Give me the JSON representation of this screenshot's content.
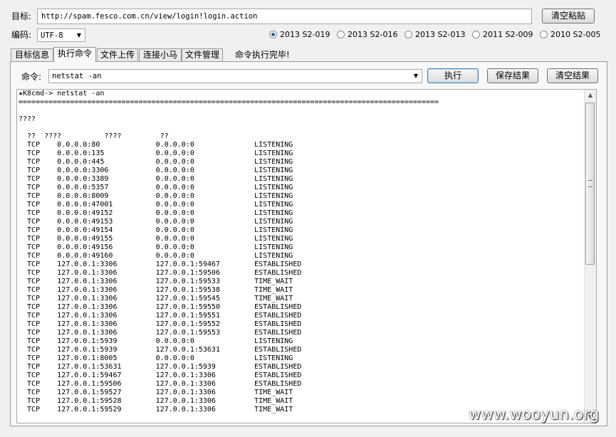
{
  "target": {
    "label": "目标:",
    "url": "http://spam.fesco.com.cn/view/login!login.action",
    "clear_paste": "清空粘贴"
  },
  "encoding": {
    "label": "编码:",
    "value": "UTF-8"
  },
  "exploits": [
    {
      "label": "2013 S2-019",
      "selected": true
    },
    {
      "label": "2013 S2-016",
      "selected": false
    },
    {
      "label": "2013 S2-013",
      "selected": false
    },
    {
      "label": "2011 S2-009",
      "selected": false
    },
    {
      "label": "2010 S2-005",
      "selected": false
    }
  ],
  "tabs": [
    "目标信息",
    "执行命令",
    "文件上传",
    "连接小马",
    "文件管理"
  ],
  "active_tab": "执行命令",
  "status": "命令执行完毕!",
  "command": {
    "label": "命令:",
    "value": "netstat -an",
    "execute": "执行",
    "save": "保存结果",
    "clear": "清空结果"
  },
  "output": {
    "prompt": "★K8cmd-> netstat -an",
    "separator": "==================================================================================================",
    "header1": "????",
    "columns": "  ??  ????          ????         ??",
    "rows": [
      [
        "TCP",
        "0.0.0.0:80",
        "0.0.0.0:0",
        "LISTENING"
      ],
      [
        "TCP",
        "0.0.0.0:135",
        "0.0.0.0:0",
        "LISTENING"
      ],
      [
        "TCP",
        "0.0.0.0:445",
        "0.0.0.0:0",
        "LISTENING"
      ],
      [
        "TCP",
        "0.0.0.0:3306",
        "0.0.0.0:0",
        "LISTENING"
      ],
      [
        "TCP",
        "0.0.0.0:3389",
        "0.0.0.0:0",
        "LISTENING"
      ],
      [
        "TCP",
        "0.0.0.0:5357",
        "0.0.0.0:0",
        "LISTENING"
      ],
      [
        "TCP",
        "0.0.0.0:8009",
        "0.0.0.0:0",
        "LISTENING"
      ],
      [
        "TCP",
        "0.0.0.0:47001",
        "0.0.0.0:0",
        "LISTENING"
      ],
      [
        "TCP",
        "0.0.0.0:49152",
        "0.0.0.0:0",
        "LISTENING"
      ],
      [
        "TCP",
        "0.0.0.0:49153",
        "0.0.0.0:0",
        "LISTENING"
      ],
      [
        "TCP",
        "0.0.0.0:49154",
        "0.0.0.0:0",
        "LISTENING"
      ],
      [
        "TCP",
        "0.0.0.0:49155",
        "0.0.0.0:0",
        "LISTENING"
      ],
      [
        "TCP",
        "0.0.0.0:49156",
        "0.0.0.0:0",
        "LISTENING"
      ],
      [
        "TCP",
        "0.0.0.0:49160",
        "0.0.0.0:0",
        "LISTENING"
      ],
      [
        "TCP",
        "127.0.0.1:3306",
        "127.0.0.1:59467",
        "ESTABLISHED"
      ],
      [
        "TCP",
        "127.0.0.1:3306",
        "127.0.0.1:59506",
        "ESTABLISHED"
      ],
      [
        "TCP",
        "127.0.0.1:3306",
        "127.0.0.1:59533",
        "TIME_WAIT"
      ],
      [
        "TCP",
        "127.0.0.1:3306",
        "127.0.0.1:59538",
        "TIME_WAIT"
      ],
      [
        "TCP",
        "127.0.0.1:3306",
        "127.0.0.1:59545",
        "TIME_WAIT"
      ],
      [
        "TCP",
        "127.0.0.1:3306",
        "127.0.0.1:59550",
        "ESTABLISHED"
      ],
      [
        "TCP",
        "127.0.0.1:3306",
        "127.0.0.1:59551",
        "ESTABLISHED"
      ],
      [
        "TCP",
        "127.0.0.1:3306",
        "127.0.0.1:59552",
        "ESTABLISHED"
      ],
      [
        "TCP",
        "127.0.0.1:3306",
        "127.0.0.1:59553",
        "ESTABLISHED"
      ],
      [
        "TCP",
        "127.0.0.1:5939",
        "0.0.0.0:0",
        "LISTENING"
      ],
      [
        "TCP",
        "127.0.0.1:5939",
        "127.0.0.1:53631",
        "ESTABLISHED"
      ],
      [
        "TCP",
        "127.0.0.1:8005",
        "0.0.0.0:0",
        "LISTENING"
      ],
      [
        "TCP",
        "127.0.0.1:53631",
        "127.0.0.1:5939",
        "ESTABLISHED"
      ],
      [
        "TCP",
        "127.0.0.1:59467",
        "127.0.0.1:3306",
        "ESTABLISHED"
      ],
      [
        "TCP",
        "127.0.0.1:59506",
        "127.0.0.1:3306",
        "ESTABLISHED"
      ],
      [
        "TCP",
        "127.0.0.1:59527",
        "127.0.0.1:3306",
        "TIME_WAIT"
      ],
      [
        "TCP",
        "127.0.0.1:59528",
        "127.0.0.1:3306",
        "TIME_WAIT"
      ],
      [
        "TCP",
        "127.0.0.1:59529",
        "127.0.0.1:3306",
        "TIME_WAIT"
      ]
    ]
  },
  "watermark": "www.wooyun.org",
  "colors": {
    "selected_radio": "#1f5fa6",
    "focus_border": "#3c7fb1"
  }
}
